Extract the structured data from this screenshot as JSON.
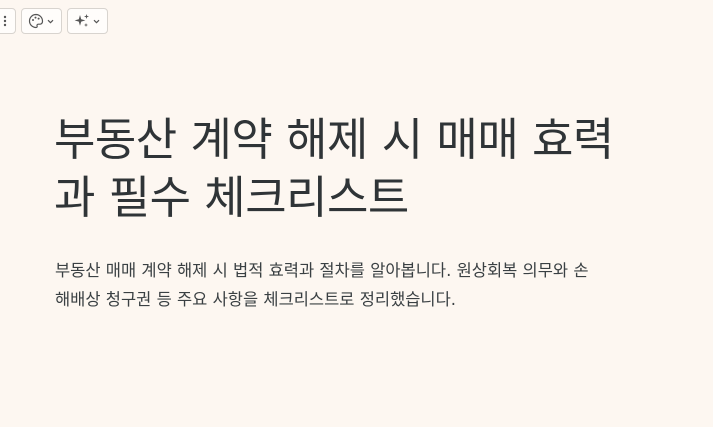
{
  "toolbar": {
    "items": [
      {
        "icon": "more-vertical-icon"
      },
      {
        "icon": "palette-icon"
      },
      {
        "icon": "sparkles-icon"
      }
    ]
  },
  "article": {
    "title": "부동산 계약 해제 시 매매 효력 과 필수 체크리스트",
    "title_line1": "부동산 계약 해제 시 매매 효력",
    "title_line2": "과 필수 체크리스트",
    "description_line1": "부동산 매매 계약 해제 시 법적 효력과 절차를 알아봅니다. 원상회복 의무와 손",
    "description_line2": "해배상 청구권 등 주요 사항을 체크리스트로 정리했습니다."
  },
  "colors": {
    "background": "#fdf7f1",
    "text": "#2f3437"
  }
}
